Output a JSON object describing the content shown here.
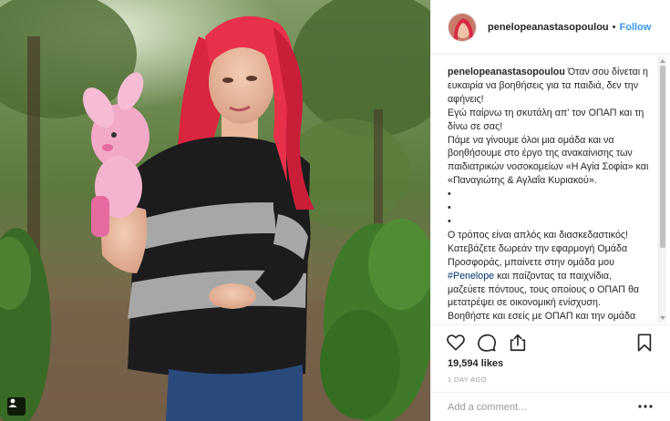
{
  "post": {
    "username": "penelopeanastasopoulou",
    "separator": "•",
    "follow_label": "Follow",
    "caption_username": "penelopeanastasopoulou",
    "caption_part1": " Όταν σου δίνεται η ευκαιρία να βοηθήσεις για τα παιδιά, δεν την αφήνεις!\nΕγώ παίρνω τη σκυτάλη απ' τον ΟΠΑΠ και τη δίνω σε σας!\nΠάμε να γίνουμε όλοι μια ομάδα και να βοηθήσουμε στο έργο της ανακαίνισης των παιδιατρικών νοσοκομείων «Η Αγία Σοφία» και «Παναγιώτης & Αγλαΐα Κυριακού».\n•\n•\n•\nΟ τρόπος είναι απλός και διασκεδαστικός! Κατεβάζετε δωρεάν την εφαρμογή Ομάδα Προσφοράς, μπαίνετε στην ομάδα μου ",
    "caption_hashtag": "#Penelope",
    "caption_part2": " και παίζοντας τα παιχνίδια, μαζεύετε πόντους, τους οποίους ο ΟΠΑΠ θα μετατρέψει σε οικονομική ενίσχυση.\nΒοηθήστε και εσείς με ΟΠΑΠ και την ομάδα",
    "likes": "19,594 likes",
    "time_ago": "1 DAY AGO",
    "comment_placeholder": "Add a comment…"
  },
  "icons": {
    "like": "heart-icon",
    "comment": "comment-icon",
    "share": "share-icon",
    "save": "bookmark-icon",
    "more": "more-options-icon",
    "user_tag": "user-tag-icon"
  },
  "colors": {
    "follow": "#3897f0",
    "text": "#262626",
    "muted": "#999999",
    "hair": "#e8304a",
    "hashtag": "#003569"
  }
}
